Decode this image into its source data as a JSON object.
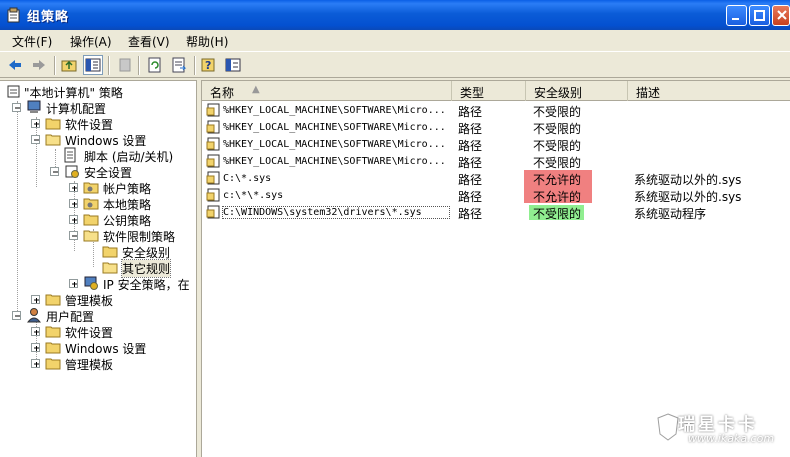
{
  "window": {
    "title": "组策略"
  },
  "menu": [
    "文件(F)",
    "操作(A)",
    "查看(V)",
    "帮助(H)"
  ],
  "tree": {
    "root": "\"本地计算机\" 策略",
    "items": [
      {
        "label": "计算机配置"
      },
      {
        "label": "软件设置"
      },
      {
        "label": "Windows 设置"
      },
      {
        "label": "脚本 (启动/关机)"
      },
      {
        "label": "安全设置"
      },
      {
        "label": "帐户策略"
      },
      {
        "label": "本地策略"
      },
      {
        "label": "公钥策略"
      },
      {
        "label": "软件限制策略"
      },
      {
        "label": "安全级别"
      },
      {
        "label": "其它规则"
      },
      {
        "label": "IP 安全策略，在"
      },
      {
        "label": "管理模板"
      },
      {
        "label": "用户配置"
      },
      {
        "label": "软件设置"
      },
      {
        "label": "Windows 设置"
      },
      {
        "label": "管理模板"
      }
    ]
  },
  "list": {
    "columns": [
      "名称",
      "类型",
      "安全级别",
      "描述"
    ],
    "rows": [
      {
        "name": "%HKEY_LOCAL_MACHINE\\SOFTWARE\\Micro...",
        "type": "路径",
        "level": "不受限的",
        "desc": ""
      },
      {
        "name": "%HKEY_LOCAL_MACHINE\\SOFTWARE\\Micro...",
        "type": "路径",
        "level": "不受限的",
        "desc": ""
      },
      {
        "name": "%HKEY_LOCAL_MACHINE\\SOFTWARE\\Micro...",
        "type": "路径",
        "level": "不受限的",
        "desc": ""
      },
      {
        "name": "%HKEY_LOCAL_MACHINE\\SOFTWARE\\Micro...",
        "type": "路径",
        "level": "不受限的",
        "desc": ""
      },
      {
        "name": "C:\\*.sys",
        "type": "路径",
        "level": "不允许的",
        "desc": "系统驱动以外的.sys"
      },
      {
        "name": "c:\\*\\*.sys",
        "type": "路径",
        "level": "不允许的",
        "desc": "系统驱动以外的.sys"
      },
      {
        "name": "C:\\WINDOWS\\system32\\drivers\\*.sys",
        "type": "路径",
        "level": "不受限的",
        "desc": "系统驱动程序"
      }
    ]
  },
  "watermark": {
    "brand": "瑞星卡卡",
    "url": "www.ikaka.com"
  },
  "colors": {
    "deny": "#f08080",
    "allow": "#90ee90",
    "titlebar": "#0450d0"
  }
}
